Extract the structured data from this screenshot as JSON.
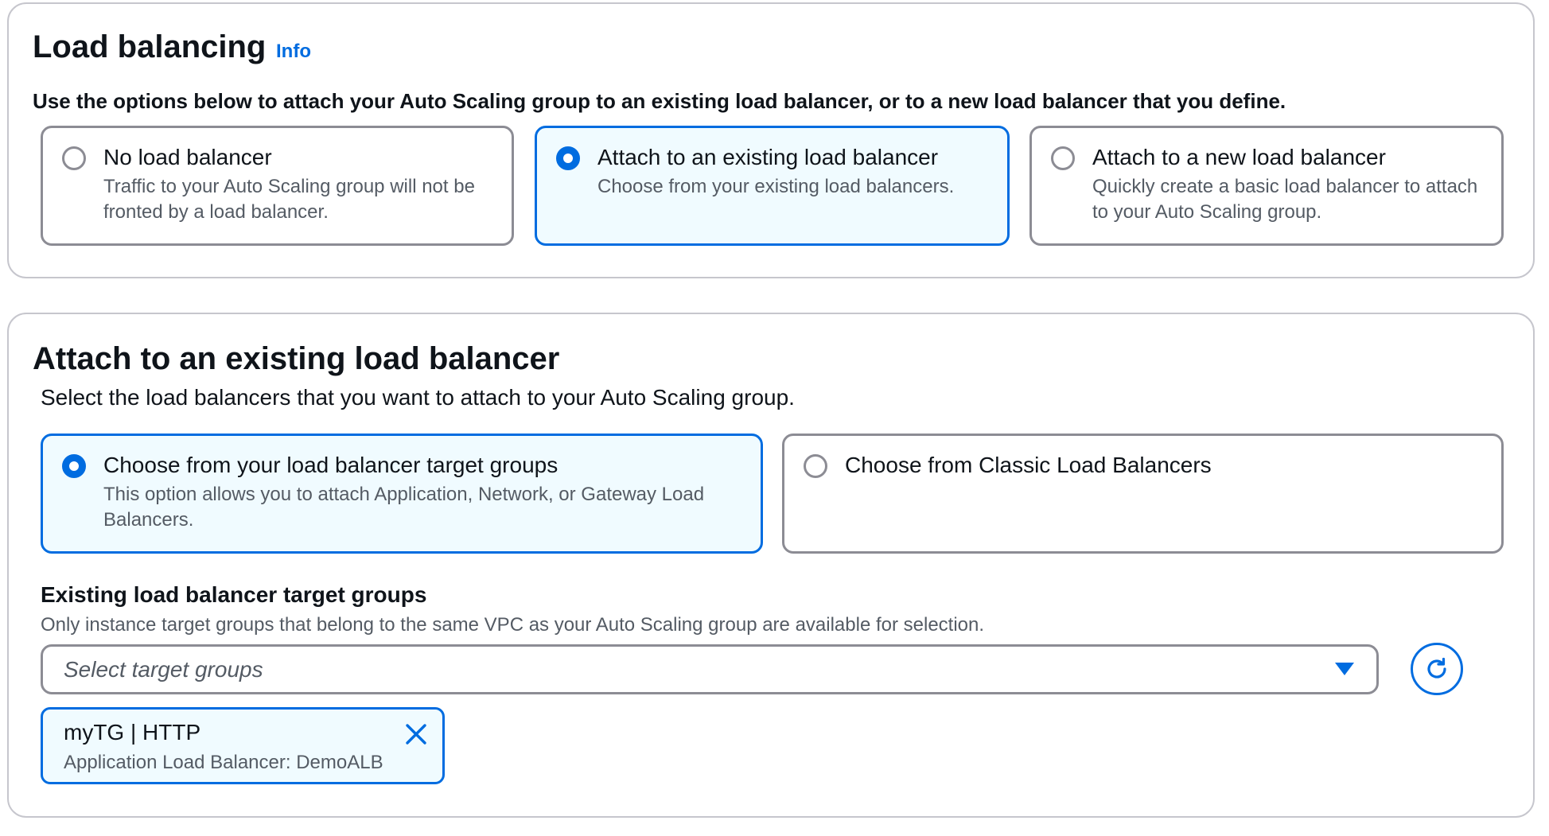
{
  "load_balancing": {
    "title": "Load balancing",
    "info_link": "Info",
    "description": "Use the options below to attach your Auto Scaling group to an existing load balancer, or to a new load balancer that you define.",
    "options": [
      {
        "label": "No load balancer",
        "description": "Traffic to your Auto Scaling group will not be fronted by a load balancer.",
        "selected": false
      },
      {
        "label": "Attach to an existing load balancer",
        "description": "Choose from your existing load balancers.",
        "selected": true
      },
      {
        "label": "Attach to a new load balancer",
        "description": "Quickly create a basic load balancer to attach to your Auto Scaling group.",
        "selected": false
      }
    ]
  },
  "attach_existing": {
    "title": "Attach to an existing load balancer",
    "description": "Select the load balancers that you want to attach to your Auto Scaling group.",
    "options": [
      {
        "label": "Choose from your load balancer target groups",
        "description": "This option allows you to attach Application, Network, or Gateway Load Balancers.",
        "selected": true
      },
      {
        "label": "Choose from Classic Load Balancers",
        "description": "",
        "selected": false
      }
    ],
    "target_groups": {
      "label": "Existing load balancer target groups",
      "description": "Only instance target groups that belong to the same VPC as your Auto Scaling group are available for selection.",
      "placeholder": "Select target groups",
      "refresh_icon": "refresh-icon",
      "selected_tokens": [
        {
          "title": "myTG | HTTP",
          "subtitle": "Application Load Balancer: DemoALB",
          "remove_icon": "close-icon"
        }
      ]
    }
  },
  "colors": {
    "accent": "#006ce0",
    "selected_bg": "#f0fbff",
    "border": "#8c8c94",
    "text": "#0f141a",
    "secondary_text": "#545b64"
  }
}
